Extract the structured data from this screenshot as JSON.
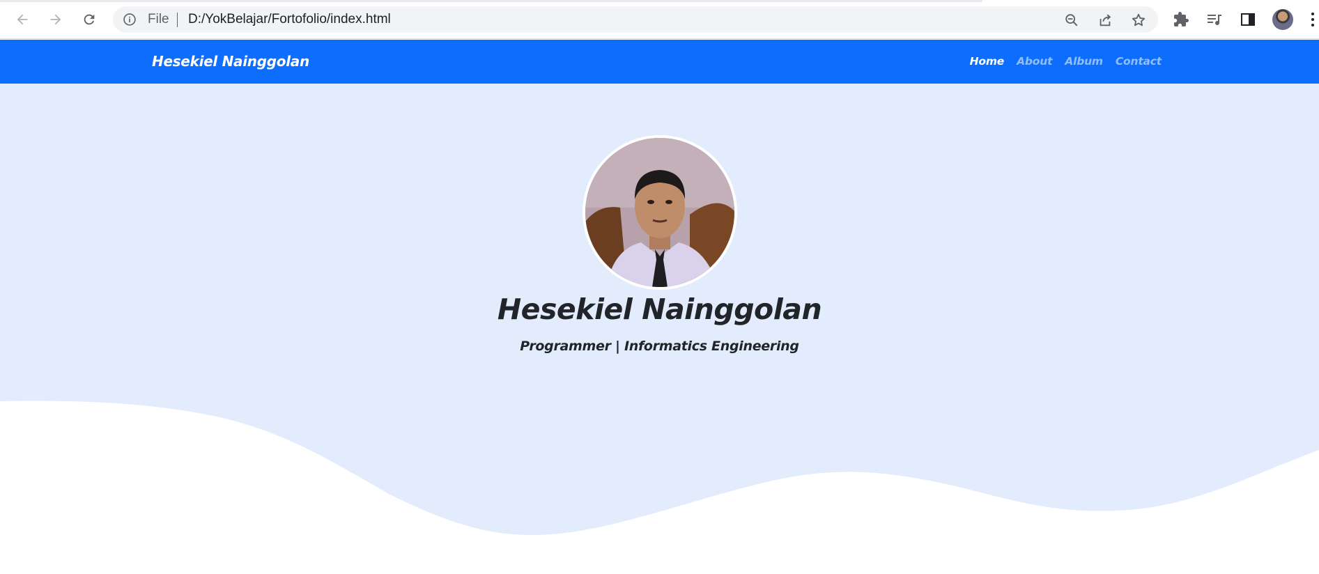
{
  "browser": {
    "url_scheme": "File",
    "url": "D:/YokBelajar/Fortofolio/index.html",
    "icons": {
      "back": "arrow-left-icon",
      "forward": "arrow-right-icon",
      "reload": "reload-icon",
      "site_info": "info-icon",
      "zoom": "zoom-out-icon",
      "share": "share-icon",
      "bookmark": "star-icon",
      "extensions": "puzzle-icon",
      "media": "media-queue-icon",
      "side_panel": "side-panel-icon",
      "profile": "avatar",
      "menu": "more-vert-icon"
    }
  },
  "site": {
    "brand": "Hesekiel Nainggolan",
    "nav": [
      {
        "label": "Home",
        "active": true
      },
      {
        "label": "About",
        "active": false
      },
      {
        "label": "Album",
        "active": false
      },
      {
        "label": "Contact",
        "active": false
      }
    ],
    "hero": {
      "name": "Hesekiel Nainggolan",
      "subtitle": "Programmer | Informatics Engineering"
    }
  },
  "colors": {
    "navbar": "#0d6efd",
    "hero_bg": "#e2ecfd",
    "wave": "#ffffff",
    "text": "#212529"
  }
}
